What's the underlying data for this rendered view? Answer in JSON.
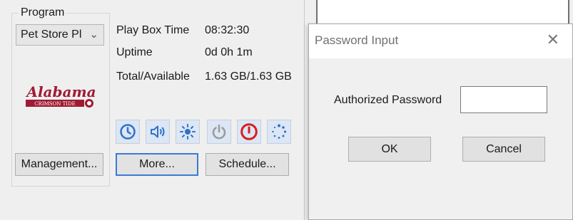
{
  "program": {
    "group_label": "Program",
    "selected": "Pet Store Pl",
    "logo_text": "Alabama",
    "logo_subtext": "CRIMSON TIDE"
  },
  "info": [
    {
      "label": "Play Box Time",
      "value": "08:32:30"
    },
    {
      "label": "Uptime",
      "value": "0d 0h 1m"
    },
    {
      "label": "Total/Available",
      "value": "1.63 GB/1.63 GB"
    }
  ],
  "toolbar_icons": [
    "clock-icon",
    "volume-icon",
    "brightness-icon",
    "power-icon",
    "shutdown-icon",
    "loading-icon"
  ],
  "buttons": {
    "management": "Management...",
    "more": "More...",
    "schedule": "Schedule..."
  },
  "dialog": {
    "title": "Password Input",
    "close_glyph": "✕",
    "password_label": "Authorized Password",
    "password_value": "",
    "ok": "OK",
    "cancel": "Cancel"
  },
  "colors": {
    "icon_blue": "#2e72c8",
    "power_gray": "#9a9a9a",
    "shutdown_red": "#d42020",
    "logo_red": "#9e1b32",
    "focus_blue": "#3b7bd4"
  }
}
